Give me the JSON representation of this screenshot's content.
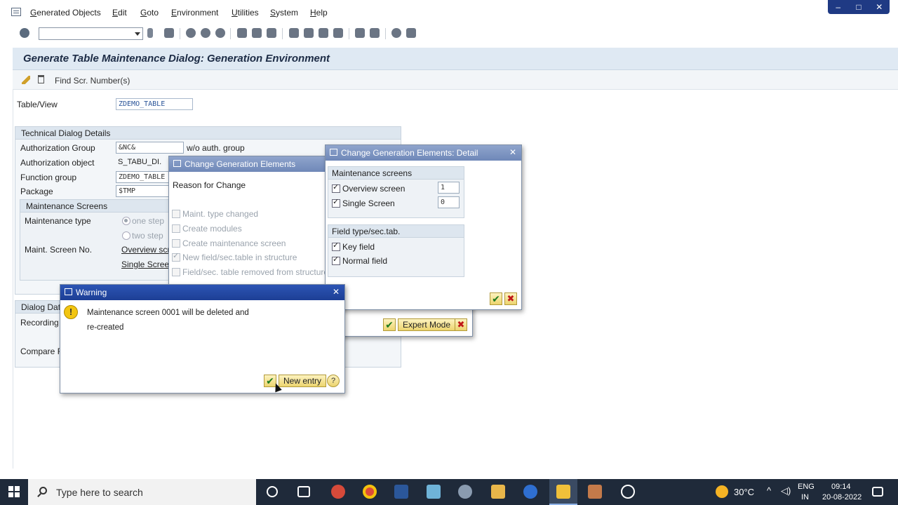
{
  "menu": [
    "Generated Objects",
    "Edit",
    "Goto",
    "Environment",
    "Utilities",
    "System",
    "Help"
  ],
  "window_controls": [
    "–",
    "□",
    "✕"
  ],
  "title": "Generate Table Maintenance Dialog: Generation Environment",
  "app_toolbar": {
    "find_label": "Find Scr. Number(s)"
  },
  "table_view": {
    "label": "Table/View",
    "value": "ZDEMO_TABLE"
  },
  "tech_details": {
    "header": "Technical Dialog Details",
    "auth_group_label": "Authorization Group",
    "auth_group_value": "&NC&",
    "auth_group_text": "w/o auth. group",
    "auth_object_label": "Authorization object",
    "auth_object_value": "S_TABU_DI.",
    "function_group_label": "Function group",
    "function_group_value": "ZDEMO_TABLE",
    "package_label": "Package",
    "package_value": "$TMP"
  },
  "maint_screens": {
    "header": "Maintenance Screens",
    "type_label": "Maintenance type",
    "one_step": "one step",
    "two_step": "two step",
    "screen_no_label": "Maint. Screen No.",
    "overview_link": "Overview scr",
    "single_link": "Single Screen"
  },
  "dialog_data": {
    "header": "Dialog Data",
    "recording_label": "Recording",
    "compare_label": "Compare Fl"
  },
  "change_gen": {
    "title": "Change Generation Elements",
    "reason": "Reason for Change",
    "options": [
      {
        "label": "Maint. type changed",
        "checked": false
      },
      {
        "label": "Create modules",
        "checked": false
      },
      {
        "label": "Create maintenance screen",
        "checked": false
      },
      {
        "label": "New field/sec.table in structure",
        "checked": true
      },
      {
        "label": "Field/sec. table removed from structure",
        "checked": false
      }
    ],
    "expert_mode": "Expert Mode"
  },
  "detail": {
    "title": "Change Generation Elements: Detail",
    "maint_header": "Maintenance screens",
    "overview_label": "Overview screen",
    "overview_value": "1",
    "single_label": "Single Screen",
    "single_value": "0",
    "field_header": "Field type/sec.tab.",
    "key_field": "Key field",
    "normal_field": "Normal field"
  },
  "warning": {
    "title": "Warning",
    "line1": "Maintenance screen 0001 will be deleted and",
    "line2": "re-created",
    "new_entry": "New entry"
  },
  "taskbar": {
    "search_placeholder": "Type here to search",
    "temperature": "30°C",
    "lang1": "ENG",
    "lang2": "IN",
    "time": "09:14",
    "date": "20-08-2022"
  }
}
